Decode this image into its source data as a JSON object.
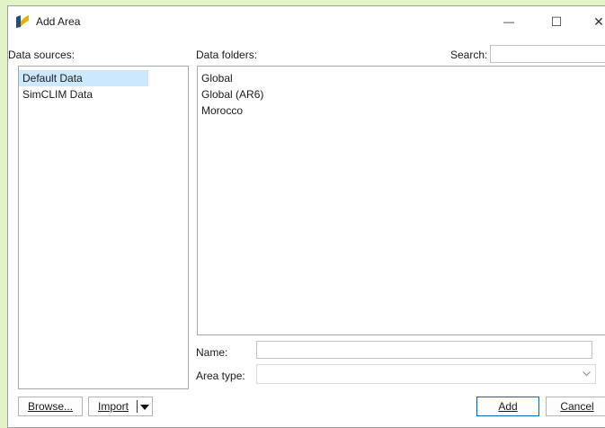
{
  "window": {
    "title": "Add Area",
    "controls": {
      "minimize": "—",
      "maximize": "☐",
      "close": "✕"
    }
  },
  "data_sources": {
    "label": "Data sources:",
    "items": [
      {
        "label": "Default Data",
        "selected": true
      },
      {
        "label": "SimCLIM Data",
        "selected": false
      }
    ]
  },
  "data_folders": {
    "label": "Data folders:",
    "items": [
      "Global",
      "Global (AR6)",
      "Morocco"
    ]
  },
  "search": {
    "label": "Search:",
    "value": ""
  },
  "name": {
    "label": "Name:",
    "value": ""
  },
  "area_type": {
    "label": "Area type:",
    "value": ""
  },
  "buttons": {
    "browse": "Browse...",
    "import": "Import",
    "add": "Add",
    "cancel": "Cancel"
  },
  "colors": {
    "selection": "#cce8ff",
    "default_button_border": "#0067c0",
    "background": "#e2f3c6"
  }
}
